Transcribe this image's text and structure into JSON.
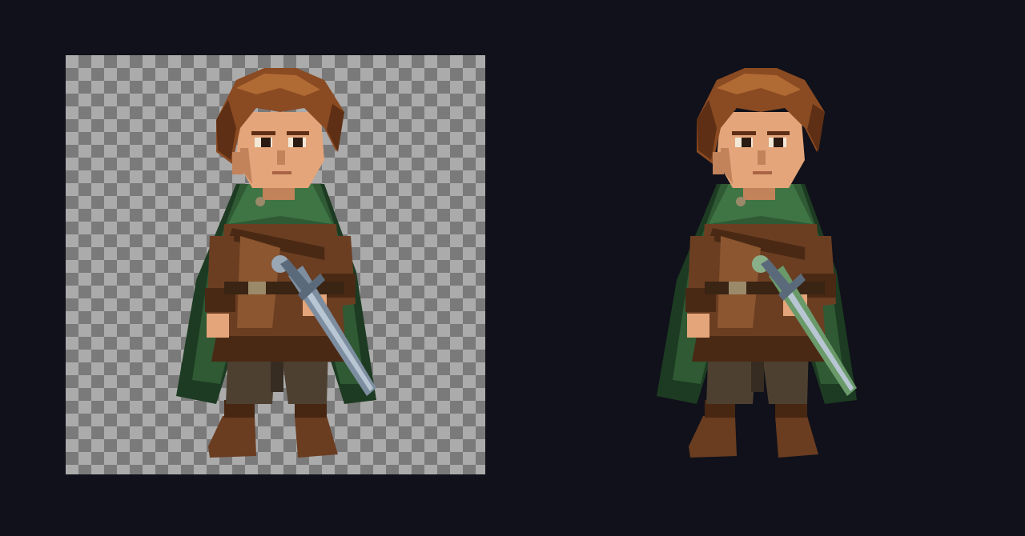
{
  "scene": {
    "background_color": "#10111a",
    "panels": [
      {
        "id": "transparent-preview",
        "backdrop": "checkerboard"
      },
      {
        "id": "dark-preview",
        "backdrop": "solid-dark"
      }
    ]
  },
  "sprite": {
    "palette": {
      "hair": "#8a4a22",
      "hair_dark": "#5e2f14",
      "hair_light": "#b06a34",
      "skin": "#e4a57a",
      "skin_shadow": "#c2825a",
      "eye": "#2a1a12",
      "cloak": "#2f5a34",
      "cloak_dark": "#1d3b22",
      "cloak_light": "#3f7444",
      "tunic": "#6b3e22",
      "tunic_dark": "#4a2914",
      "tunic_light": "#8b5630",
      "belt": "#3a2414",
      "buckle": "#9a8a6a",
      "pants": "#4e4030",
      "pants_dark": "#362c22",
      "boot": "#6a3c20",
      "boot_dark": "#472612",
      "blade": "#7d8ea0",
      "blade_light": "#b8c6d4",
      "hilt": "#5a6a7a",
      "pommel": "#9aa8b6",
      "blade_tinted": "#6a9a6a",
      "pommel_tinted": "#8ab08a"
    }
  }
}
